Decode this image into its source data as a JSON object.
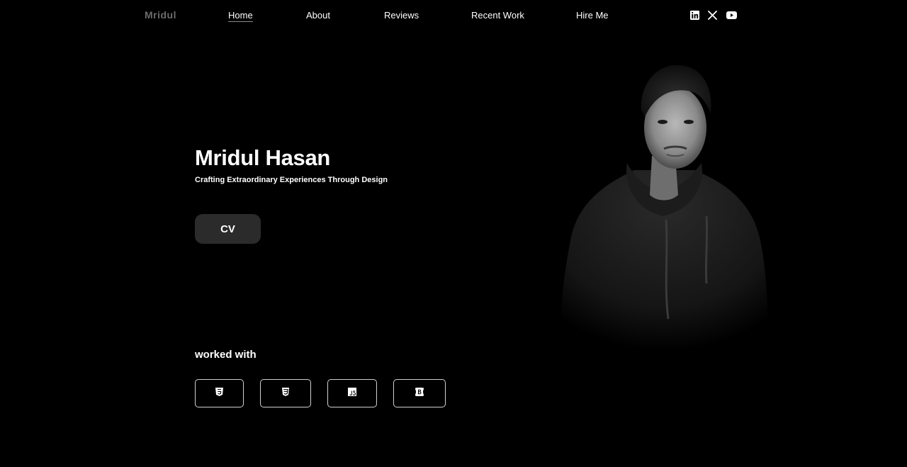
{
  "nav": {
    "brand": "Mridul",
    "links": [
      "Home",
      "About",
      "Reviews",
      "Recent Work",
      "Hire Me"
    ],
    "active": "Home"
  },
  "social": [
    "linkedin-icon",
    "x-icon",
    "youtube-icon"
  ],
  "hero": {
    "name": "Mridul Hasan",
    "tagline": "Crafting Extraordinary Experiences Through Design",
    "cv_label": "CV"
  },
  "worked_with": {
    "title": "worked with",
    "tech": [
      "html5-icon",
      "css3-icon",
      "javascript-icon",
      "bootstrap-icon"
    ]
  },
  "colors": {
    "background": "#000000",
    "text": "#ffffff",
    "brand": "#6b6b6b",
    "button": "#2b2b2b",
    "border": "#d0d0d0"
  }
}
